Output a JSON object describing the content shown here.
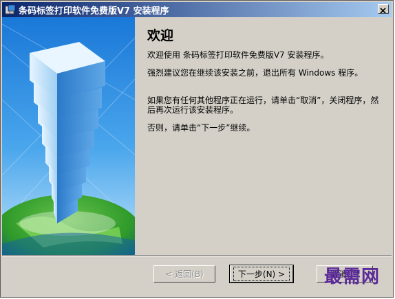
{
  "window": {
    "title": "条码标签打印软件免费版V7  安装程序",
    "close_symbol": "×",
    "icon": "installer-icon"
  },
  "main": {
    "heading": "欢迎",
    "p1": "欢迎使用 条码标签打印软件免费版V7  安装程序。",
    "p2": "强烈建议您在继续该安装之前，退出所有 Windows 程序。",
    "p3": "如果您有任何其他程序正在运行，请单击“取消”，关闭程序，然后再次运行该安装程序。",
    "p4": "否则，请单击“下一步”继续。"
  },
  "buttons": {
    "back": "< 返回(B)",
    "next": "下一步(N) >",
    "cancel": "取消(C)"
  },
  "watermark": "最需网",
  "colors": {
    "titlebar_start": "#0a246a",
    "titlebar_end": "#a6caf0",
    "dialog_bg": "#d4d0c8",
    "watermark": "#5b2a9a"
  }
}
